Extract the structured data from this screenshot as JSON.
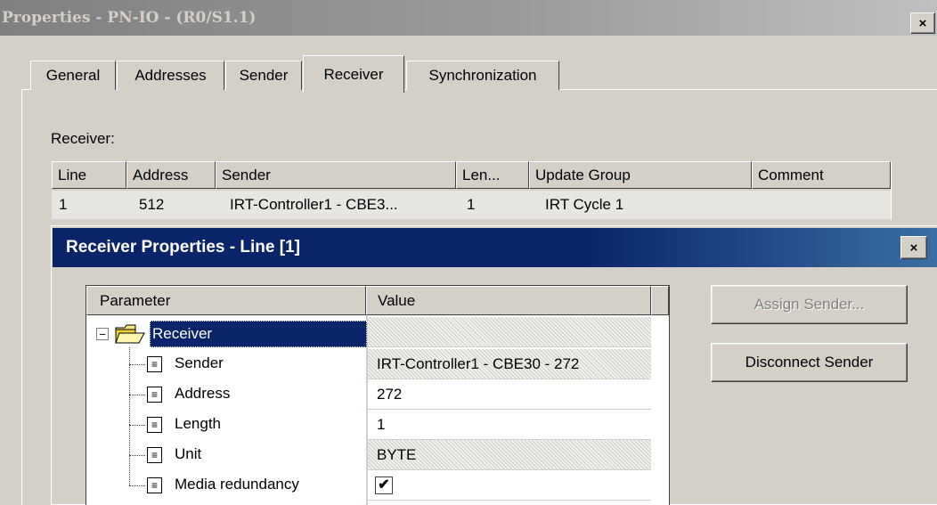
{
  "outer": {
    "title": "Properties - PN-IO - (R0/S1.1)",
    "close_glyph": "×",
    "tabs": [
      "General",
      "Addresses",
      "Sender",
      "Receiver",
      "Synchronization"
    ],
    "active_tab": "Receiver",
    "receiver_caption": "Receiver:",
    "list": {
      "columns": [
        "Line",
        "Address",
        "Sender",
        "Len...",
        "Update Group",
        "Comment"
      ],
      "rows": [
        {
          "line": "1",
          "address": "512",
          "sender": "IRT-Controller1 - CBE3...",
          "len": "1",
          "update_group": "IRT Cycle 1",
          "comment": ""
        }
      ]
    }
  },
  "dialog": {
    "title": "Receiver Properties - Line [1]",
    "close_glyph": "×",
    "grid": {
      "columns": [
        "Parameter",
        "Value"
      ],
      "root": {
        "label": "Receiver",
        "expander": "−",
        "icon": "folder-open-icon"
      },
      "params": [
        {
          "label": "Sender",
          "value": "IRT-Controller1 - CBE30 - 272",
          "readonly": true,
          "icon": "document-icon"
        },
        {
          "label": "Address",
          "value": "272",
          "readonly": false,
          "icon": "document-icon"
        },
        {
          "label": "Length",
          "value": "1",
          "readonly": false,
          "icon": "document-icon"
        },
        {
          "label": "Unit",
          "value": "BYTE",
          "readonly": true,
          "icon": "document-icon"
        },
        {
          "label": "Media redundancy",
          "value": "✔",
          "readonly": false,
          "icon": "document-icon"
        }
      ]
    },
    "buttons": {
      "assign_sender": "Assign Sender...",
      "disconnect_sender": "Disconnect Sender"
    }
  },
  "colors": {
    "face": "#d4d0c8",
    "active_title": "#0a246a",
    "inactive_title": "#808080",
    "selection": "#0a246a"
  }
}
